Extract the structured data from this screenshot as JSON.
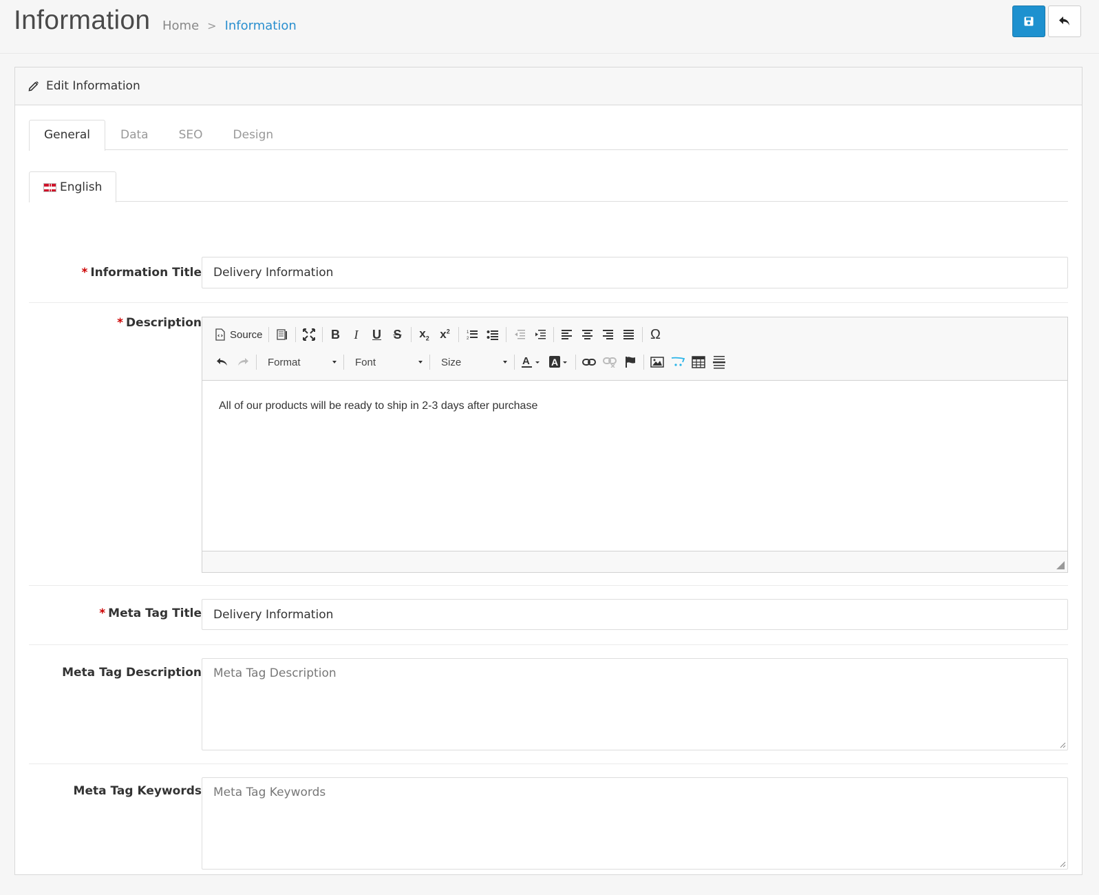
{
  "header": {
    "title": "Information",
    "breadcrumb": {
      "home": "Home",
      "separator": ">",
      "current": "Information"
    },
    "buttons": {
      "save": "save-icon",
      "back": "reply-icon"
    }
  },
  "panel": {
    "heading": "Edit Information",
    "tabs": [
      "General",
      "Data",
      "SEO",
      "Design"
    ],
    "active_tab": "General",
    "language_tab": "English"
  },
  "form": {
    "information_title": {
      "label": "Information Title",
      "value": "Delivery Information",
      "required": true
    },
    "description": {
      "label": "Description",
      "required": true,
      "toolbar": {
        "source_label": "Source",
        "format_label": "Format",
        "font_label": "Font",
        "size_label": "Size",
        "omega": "Ω"
      },
      "content": "All of our products will be ready to ship in 2-3 days after purchase"
    },
    "meta_title": {
      "label": "Meta Tag Title",
      "value": "Delivery Information",
      "required": true
    },
    "meta_description": {
      "label": "Meta Tag Description",
      "placeholder": "Meta Tag Description"
    },
    "meta_keywords": {
      "label": "Meta Tag Keywords",
      "placeholder": "Meta Tag Keywords"
    },
    "required_marker": "*"
  },
  "colors": {
    "primary": "#1e91cf",
    "breadcrumb_active": "#2a8fcf",
    "required": "#cc0000"
  }
}
